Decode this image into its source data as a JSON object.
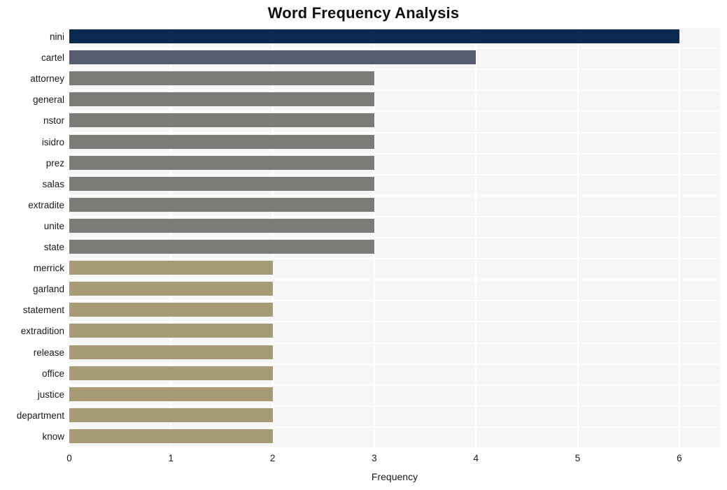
{
  "chart_data": {
    "type": "bar",
    "orientation": "horizontal",
    "title": "Word Frequency Analysis",
    "xlabel": "Frequency",
    "ylabel": "",
    "xlim": [
      0,
      6.4
    ],
    "xticks": [
      0,
      1,
      2,
      3,
      4,
      5,
      6
    ],
    "xtick_labels": [
      "0",
      "1",
      "2",
      "3",
      "4",
      "5",
      "6"
    ],
    "grid": true,
    "grid_axis": "x",
    "legend": null,
    "categories": [
      "nini",
      "cartel",
      "attorney",
      "general",
      "nstor",
      "isidro",
      "prez",
      "salas",
      "extradite",
      "unite",
      "state",
      "merrick",
      "garland",
      "statement",
      "extradition",
      "release",
      "office",
      "justice",
      "department",
      "know"
    ],
    "values": [
      6,
      4,
      3,
      3,
      3,
      3,
      3,
      3,
      3,
      3,
      3,
      2,
      2,
      2,
      2,
      2,
      2,
      2,
      2,
      2
    ],
    "bar_colors": [
      "#0a2a52",
      "#565d6e",
      "#7b7b78",
      "#7b7b78",
      "#7b7b78",
      "#7b7b78",
      "#7b7b78",
      "#7b7b78",
      "#7b7b78",
      "#7b7b78",
      "#7b7b78",
      "#a69b73",
      "#a69b73",
      "#a69b73",
      "#a69b73",
      "#a69b73",
      "#a69b73",
      "#a69b73",
      "#a69b73",
      "#a69b73"
    ],
    "plot_background": "#f6f6f7",
    "figure_background": "#ffffff",
    "gridline_color": "#ffffff"
  }
}
